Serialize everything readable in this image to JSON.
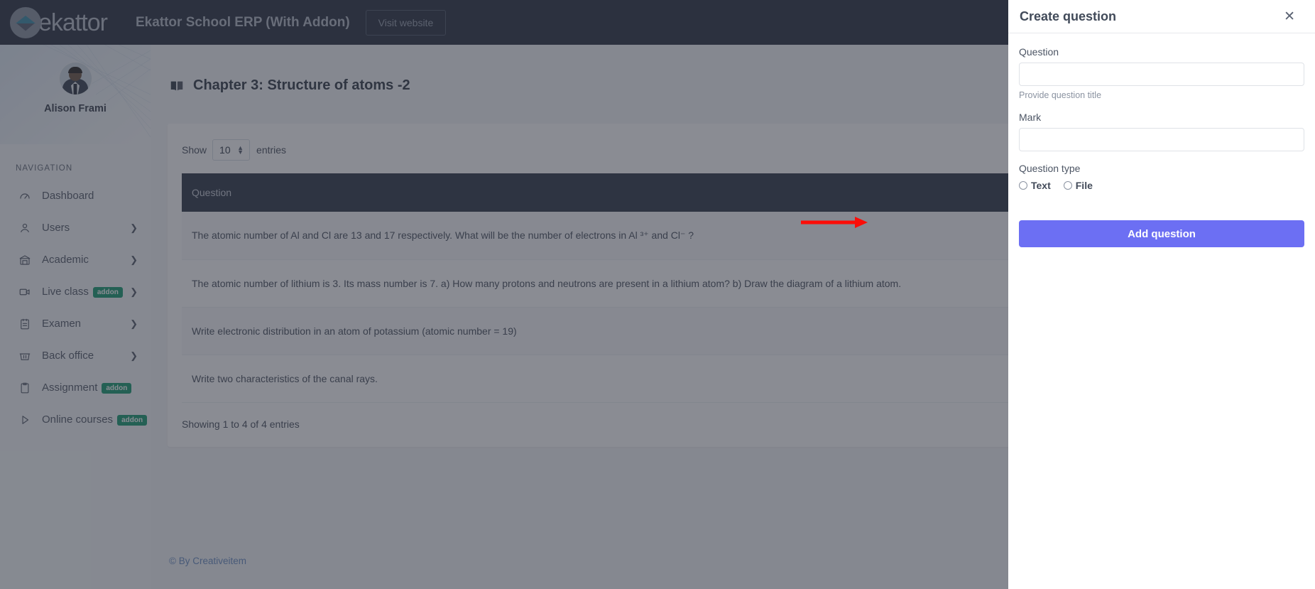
{
  "topbar": {
    "logo_word": "ekattor",
    "logo_icon": "graduation-cap-icon",
    "app_title": "Ekattor School ERP (With Addon)",
    "visit_website_label": "Visit website"
  },
  "sidebar": {
    "user_name": "Alison Frami",
    "section_label": "NAVIGATION",
    "items": [
      {
        "label": "Dashboard",
        "icon": "speedometer-icon",
        "badge": "",
        "chevron": false
      },
      {
        "label": "Users",
        "icon": "user-icon",
        "badge": "",
        "chevron": true
      },
      {
        "label": "Academic",
        "icon": "bank-icon",
        "badge": "",
        "chevron": true
      },
      {
        "label": "Live class",
        "icon": "video-camera-icon",
        "badge": "addon",
        "chevron": true
      },
      {
        "label": "Examen",
        "icon": "clipboard-icon",
        "badge": "",
        "chevron": true
      },
      {
        "label": "Back office",
        "icon": "basket-icon",
        "badge": "",
        "chevron": true
      },
      {
        "label": "Assignment",
        "icon": "clipboard-icon",
        "badge": "addon",
        "chevron": false
      },
      {
        "label": "Online courses",
        "icon": "play-icon",
        "badge": "addon",
        "chevron": false
      }
    ]
  },
  "main": {
    "page_icon": "open-book-icon",
    "page_title": "Chapter 3: Structure of atoms -2",
    "datatable": {
      "show_label": "Show",
      "entries_label": "entries",
      "page_length": "10",
      "columns": [
        "Question"
      ],
      "rows": [
        [
          "The atomic number of Al and Cl are 13 and 17 respectively. What will be the number of electrons in Al ³⁺ and Cl⁻ ?"
        ],
        [
          "The atomic number of lithium is 3. Its mass number is 7. a) How many protons and neutrons are present in a lithium atom? b) Draw the diagram of a lithium atom."
        ],
        [
          "Write electronic distribution in an atom of potassium (atomic number = 19)"
        ],
        [
          "Write two characteristics of the canal rays."
        ]
      ],
      "info": "Showing 1 to 4 of 4 entries"
    },
    "footer": "© By Creativeitem"
  },
  "offcanvas": {
    "title": "Create question",
    "close_icon": "close-icon",
    "question_label": "Question",
    "question_value": "",
    "question_placeholder": "",
    "question_help": "Provide question title",
    "mark_label": "Mark",
    "mark_value": "",
    "mark_placeholder": "",
    "question_type_label": "Question type",
    "type_options": [
      {
        "label": "Text",
        "selected": false
      },
      {
        "label": "File",
        "selected": false
      }
    ],
    "submit_label": "Add question"
  },
  "annotation": {
    "arrow_color": "#fb0d08",
    "arrow_direction": "right",
    "points_to": "Add question"
  },
  "colors": {
    "accent": "#6c6ff3",
    "topbar_bg": "#2f3545",
    "table_header_bg": "#343c4d",
    "badge_green": "#1e9e74",
    "link_blue": "#6d90c4",
    "annotation_red": "#fb0d08"
  }
}
